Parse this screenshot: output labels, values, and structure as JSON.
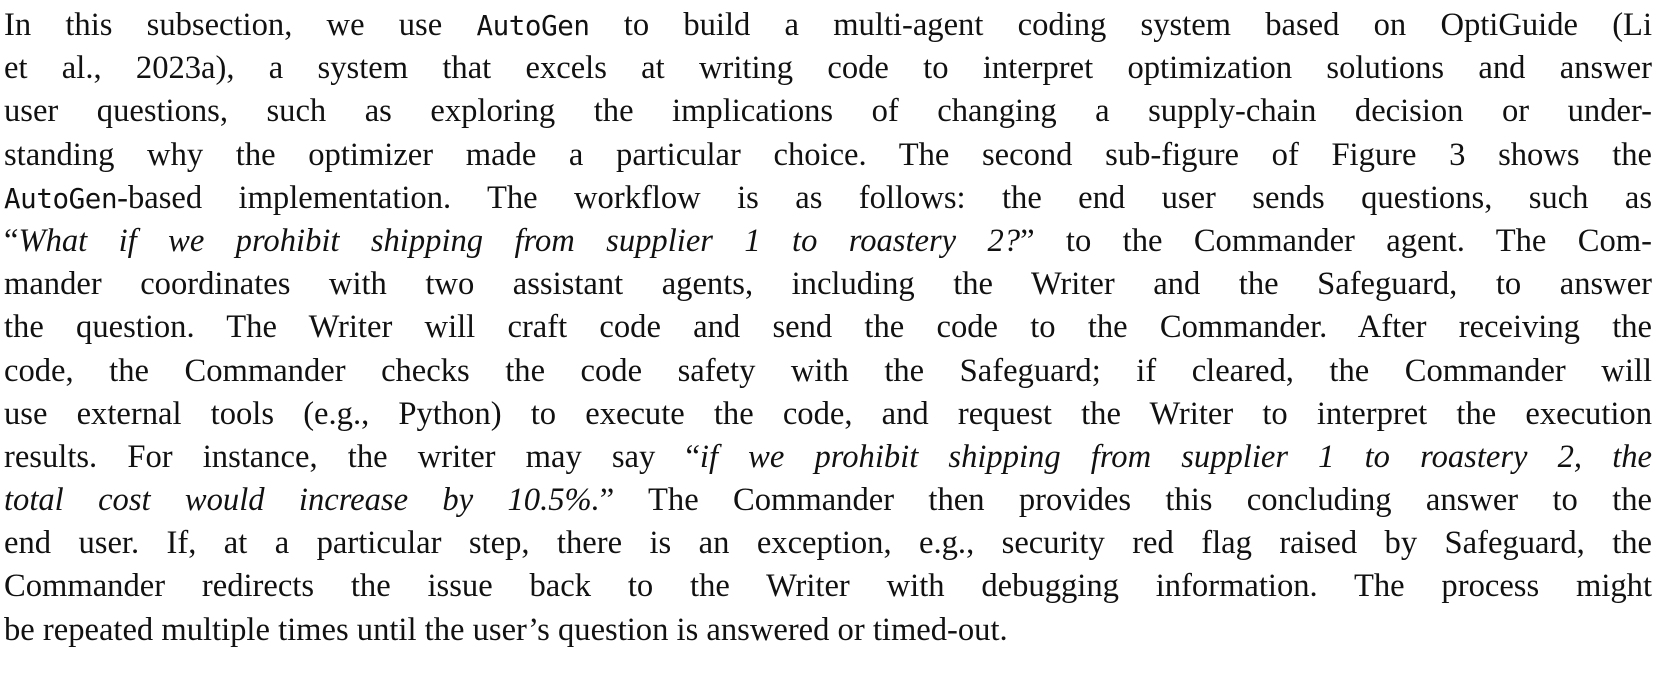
{
  "paragraph": {
    "l1": {
      "a": "In this subsection, we use ",
      "code": "AutoGen",
      "b": " to build a multi-agent coding system based on OptiGuide (Li"
    },
    "l2": "et al., 2023a), a system that excels at writing code to interpret optimization solutions and answer",
    "l3": "user questions, such as exploring the implications of changing a supply-chain decision or under-",
    "l4": "standing why the optimizer made a particular choice. The second sub-figure of Figure 3 shows the",
    "l5": {
      "code": "AutoGen",
      "b": "-based implementation. The workflow is as follows: the end user sends questions, such as"
    },
    "l6": {
      "open_quote": "“",
      "quote": "What if we prohibit shipping from supplier 1 to roastery 2?",
      "b": "” to the Commander agent. The Com-"
    },
    "l7": "mander coordinates with two assistant agents, including the Writer and the Safeguard, to answer",
    "l8": "the question. The Writer will craft code and send the code to the Commander. After receiving the",
    "l9": "code, the Commander checks the code safety with the Safeguard; if cleared, the Commander will",
    "l10": "use external tools (e.g., Python) to execute the code, and request the Writer to interpret the execution",
    "l11": {
      "a": "results. For instance, the writer may say “",
      "quote": "if we prohibit shipping from supplier 1 to roastery 2, the"
    },
    "l12": {
      "quote": "total cost would increase by 10.5%.",
      "b": "” The Commander then provides this concluding answer to the"
    },
    "l13": "end user. If, at a particular step, there is an exception, e.g., security red flag raised by Safeguard, the",
    "l14": "Commander redirects the issue back to the Writer with debugging information. The process might",
    "l15": "be repeated multiple times until the user’s question is answered or timed-out."
  }
}
